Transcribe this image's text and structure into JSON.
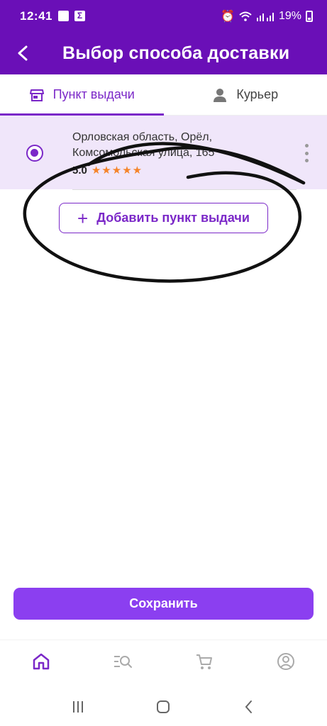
{
  "status_bar": {
    "time": "12:41",
    "battery": "19%",
    "icons": [
      "gallery-icon",
      "sigma-icon",
      "alarm-icon",
      "wifi-icon",
      "signal-icon",
      "battery-icon"
    ]
  },
  "header": {
    "title": "Выбор способа доставки",
    "back_icon": "chevron-left-icon",
    "background": "#6a0fb7"
  },
  "tabs": [
    {
      "label": "Пункт выдачи",
      "icon": "store-icon",
      "active": true
    },
    {
      "label": "Курьер",
      "icon": "courier-icon",
      "active": false
    }
  ],
  "pickup_point": {
    "address_line1": "Орловская область, Орёл,",
    "address_line2": "Комсомольская улица, 165",
    "rating": "5.0",
    "stars": "★★★★★",
    "selected": true
  },
  "add_pickup_label": "Добавить пункт выдачи",
  "save_label": "Сохранить",
  "bottom_nav": [
    {
      "icon": "home-icon",
      "active": true
    },
    {
      "icon": "catalog-search-icon",
      "active": false
    },
    {
      "icon": "cart-icon",
      "active": false
    },
    {
      "icon": "profile-icon",
      "active": false
    }
  ],
  "colors": {
    "accent": "#7b28c8",
    "save_button": "#8b3ff0",
    "card_background": "#f0e6fa",
    "stars": "#f5842a"
  }
}
